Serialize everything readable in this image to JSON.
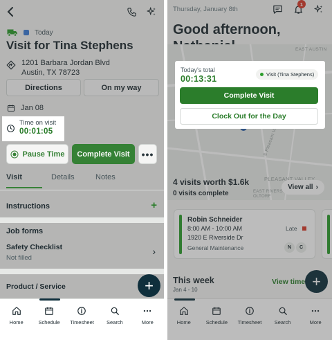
{
  "left": {
    "visit_type": "Today",
    "title": "Visit for Tina Stephens",
    "address_line1": "1201 Barbara Jordan Blvd",
    "address_line2": "Austin, TX 78723",
    "directions_label": "Directions",
    "on_my_way_label": "On my way",
    "date": "Jan 08",
    "time_on_visit_label": "Time on visit",
    "time_on_visit_value": "00:01:05",
    "pause_label": "Pause Time",
    "complete_label": "Complete Visit",
    "more_label": "•••",
    "tabs": [
      "Visit",
      "Details",
      "Notes"
    ],
    "instructions_label": "Instructions",
    "job_forms_label": "Job forms",
    "safety_checklist_label": "Safety Checklist",
    "safety_checklist_status": "Not filled",
    "product_service_label": "Product / Service"
  },
  "right": {
    "date": "Thursday, January 8th",
    "notification_count": "1",
    "greeting_line1": "Good afternoon,",
    "greeting_line2": "Nathaniel",
    "today_total_label": "Today's total",
    "today_total_value": "00:13:31",
    "active_visit_chip": "Visit (Tina Stephens)",
    "complete_label": "Complete Visit",
    "clock_out_label": "Clock Out for the Day",
    "map_labels": [
      "EAST AUSTIN",
      "PLEASANT VALLEY",
      "EAST RIVERSIDE - OLTORF"
    ],
    "street_label": "S Pleasant Valley Rd",
    "visits_summary": "4 visits worth $1.6k",
    "visits_complete": "0 visits complete",
    "view_all_label": "View all",
    "visit_card": {
      "name": "Robin Schneider",
      "time": "8:00 AM - 10:00 AM",
      "address": "1920 E Riverside Dr",
      "type": "General Maintenance",
      "status": "Late",
      "initials": [
        "N",
        "C"
      ]
    },
    "this_week_label": "This week",
    "week_range": "Jan 4 - 10",
    "view_time_label": "View time"
  },
  "nav": {
    "items": [
      "Home",
      "Schedule",
      "Timesheet",
      "Search",
      "More"
    ]
  },
  "colors": {
    "brand_green": "#2b7d2b",
    "navy": "#0f2f3c",
    "alert_red": "#d83a2a"
  }
}
